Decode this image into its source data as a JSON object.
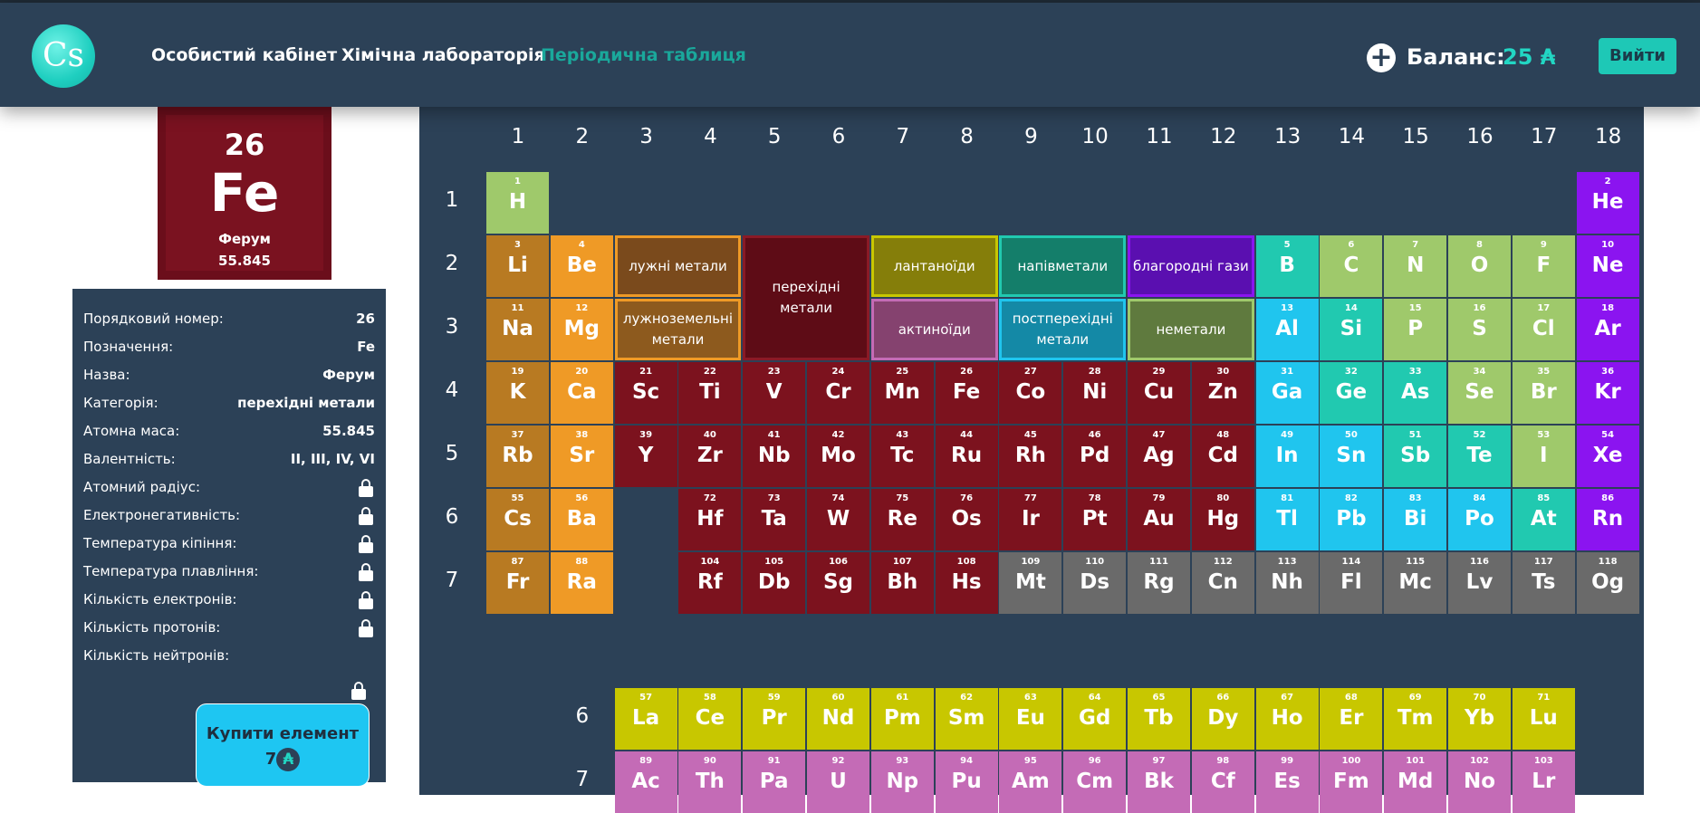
{
  "header": {
    "logo_text": "Cs",
    "nav": [
      "Особистий кабінет",
      "Хімічна лабораторія",
      "Періодична таблиця"
    ],
    "balance_label": "Баланс:",
    "balance_value": "25 ₳",
    "login": "Вийти"
  },
  "selected": {
    "number": "26",
    "symbol": "Fe",
    "name": "Ферум",
    "mass": "55.845"
  },
  "info": [
    {
      "label": "Порядковий номер:",
      "value": "26"
    },
    {
      "label": "Позначення:",
      "value": "Fe"
    },
    {
      "label": "Назва:",
      "value": "Ферум"
    },
    {
      "label": "Категорія:",
      "value": "перехідні метали"
    },
    {
      "label": "Атомна маса:",
      "value": "55.845"
    },
    {
      "label": "Валентність:",
      "value": "II, III, IV, VI"
    },
    {
      "label": "Атомний радіус:",
      "locked": true
    },
    {
      "label": "Електронегативність:",
      "locked": true
    },
    {
      "label": "Температура кіпіння:",
      "locked": true
    },
    {
      "label": "Температура плавління:",
      "locked": true
    },
    {
      "label": "Кількість електронів:",
      "locked": true
    },
    {
      "label": "Кількість протонів:",
      "locked": true
    },
    {
      "label": "Кількість нейтронів:",
      "locked": true
    }
  ],
  "buy": {
    "label": "Купити елемент",
    "price": "7",
    "currency": "₳"
  },
  "groups": [
    "1",
    "2",
    "3",
    "4",
    "5",
    "6",
    "7",
    "8",
    "9",
    "10",
    "11",
    "12",
    "13",
    "14",
    "15",
    "16",
    "17",
    "18"
  ],
  "periods": [
    "1",
    "2",
    "3",
    "4",
    "5",
    "6",
    "7"
  ],
  "series_period_labels": [
    "6",
    "7"
  ],
  "category_colors": {
    "alkali": "#b87a22",
    "alkaline": "#ef9a26",
    "transition": "#7c121e",
    "lanthanoid": "#c8c700",
    "actinoid": "#c46bb6",
    "metalloid": "#21c9b0",
    "noble": "#8b14f0",
    "post": "#20c5ee",
    "nonmetal": "#9fc96b",
    "unknown": "#6a6a6a"
  },
  "legend": [
    {
      "key": "alkali",
      "label": "лужні метали"
    },
    {
      "key": "alkaline",
      "label": "лужноземельні метали"
    },
    {
      "key": "transition",
      "label": "перехідні метали"
    },
    {
      "key": "lanthanoid",
      "label": "лантаноїди"
    },
    {
      "key": "actinoid",
      "label": "актиноїди"
    },
    {
      "key": "metalloid",
      "label": "напівметали"
    },
    {
      "key": "post",
      "label": "постперехідні метали"
    },
    {
      "key": "noble",
      "label": "благородні гази"
    },
    {
      "key": "nonmetal",
      "label": "неметали"
    }
  ],
  "elements": [
    {
      "n": 1,
      "s": "H",
      "c": "nonmetal",
      "g": 1,
      "p": 1
    },
    {
      "n": 2,
      "s": "He",
      "c": "noble",
      "g": 18,
      "p": 1
    },
    {
      "n": 3,
      "s": "Li",
      "c": "alkali",
      "g": 1,
      "p": 2
    },
    {
      "n": 4,
      "s": "Be",
      "c": "alkaline",
      "g": 2,
      "p": 2
    },
    {
      "n": 5,
      "s": "B",
      "c": "metalloid",
      "g": 13,
      "p": 2
    },
    {
      "n": 6,
      "s": "C",
      "c": "nonmetal",
      "g": 14,
      "p": 2
    },
    {
      "n": 7,
      "s": "N",
      "c": "nonmetal",
      "g": 15,
      "p": 2
    },
    {
      "n": 8,
      "s": "O",
      "c": "nonmetal",
      "g": 16,
      "p": 2
    },
    {
      "n": 9,
      "s": "F",
      "c": "nonmetal",
      "g": 17,
      "p": 2
    },
    {
      "n": 10,
      "s": "Ne",
      "c": "noble",
      "g": 18,
      "p": 2
    },
    {
      "n": 11,
      "s": "Na",
      "c": "alkali",
      "g": 1,
      "p": 3
    },
    {
      "n": 12,
      "s": "Mg",
      "c": "alkaline",
      "g": 2,
      "p": 3
    },
    {
      "n": 13,
      "s": "Al",
      "c": "post",
      "g": 13,
      "p": 3
    },
    {
      "n": 14,
      "s": "Si",
      "c": "metalloid",
      "g": 14,
      "p": 3
    },
    {
      "n": 15,
      "s": "P",
      "c": "nonmetal",
      "g": 15,
      "p": 3
    },
    {
      "n": 16,
      "s": "S",
      "c": "nonmetal",
      "g": 16,
      "p": 3
    },
    {
      "n": 17,
      "s": "Cl",
      "c": "nonmetal",
      "g": 17,
      "p": 3
    },
    {
      "n": 18,
      "s": "Ar",
      "c": "noble",
      "g": 18,
      "p": 3
    },
    {
      "n": 19,
      "s": "K",
      "c": "alkali",
      "g": 1,
      "p": 4
    },
    {
      "n": 20,
      "s": "Ca",
      "c": "alkaline",
      "g": 2,
      "p": 4
    },
    {
      "n": 21,
      "s": "Sc",
      "c": "transition",
      "g": 3,
      "p": 4
    },
    {
      "n": 22,
      "s": "Ti",
      "c": "transition",
      "g": 4,
      "p": 4
    },
    {
      "n": 23,
      "s": "V",
      "c": "transition",
      "g": 5,
      "p": 4
    },
    {
      "n": 24,
      "s": "Cr",
      "c": "transition",
      "g": 6,
      "p": 4
    },
    {
      "n": 25,
      "s": "Mn",
      "c": "transition",
      "g": 7,
      "p": 4
    },
    {
      "n": 26,
      "s": "Fe",
      "c": "transition",
      "g": 8,
      "p": 4
    },
    {
      "n": 27,
      "s": "Co",
      "c": "transition",
      "g": 9,
      "p": 4
    },
    {
      "n": 28,
      "s": "Ni",
      "c": "transition",
      "g": 10,
      "p": 4
    },
    {
      "n": 29,
      "s": "Cu",
      "c": "transition",
      "g": 11,
      "p": 4
    },
    {
      "n": 30,
      "s": "Zn",
      "c": "transition",
      "g": 12,
      "p": 4
    },
    {
      "n": 31,
      "s": "Ga",
      "c": "post",
      "g": 13,
      "p": 4
    },
    {
      "n": 32,
      "s": "Ge",
      "c": "metalloid",
      "g": 14,
      "p": 4
    },
    {
      "n": 33,
      "s": "As",
      "c": "metalloid",
      "g": 15,
      "p": 4
    },
    {
      "n": 34,
      "s": "Se",
      "c": "nonmetal",
      "g": 16,
      "p": 4
    },
    {
      "n": 35,
      "s": "Br",
      "c": "nonmetal",
      "g": 17,
      "p": 4
    },
    {
      "n": 36,
      "s": "Kr",
      "c": "noble",
      "g": 18,
      "p": 4
    },
    {
      "n": 37,
      "s": "Rb",
      "c": "alkali",
      "g": 1,
      "p": 5
    },
    {
      "n": 38,
      "s": "Sr",
      "c": "alkaline",
      "g": 2,
      "p": 5
    },
    {
      "n": 39,
      "s": "Y",
      "c": "transition",
      "g": 3,
      "p": 5
    },
    {
      "n": 40,
      "s": "Zr",
      "c": "transition",
      "g": 4,
      "p": 5
    },
    {
      "n": 41,
      "s": "Nb",
      "c": "transition",
      "g": 5,
      "p": 5
    },
    {
      "n": 42,
      "s": "Mo",
      "c": "transition",
      "g": 6,
      "p": 5
    },
    {
      "n": 43,
      "s": "Tc",
      "c": "transition",
      "g": 7,
      "p": 5
    },
    {
      "n": 44,
      "s": "Ru",
      "c": "transition",
      "g": 8,
      "p": 5
    },
    {
      "n": 45,
      "s": "Rh",
      "c": "transition",
      "g": 9,
      "p": 5
    },
    {
      "n": 46,
      "s": "Pd",
      "c": "transition",
      "g": 10,
      "p": 5
    },
    {
      "n": 47,
      "s": "Ag",
      "c": "transition",
      "g": 11,
      "p": 5
    },
    {
      "n": 48,
      "s": "Cd",
      "c": "transition",
      "g": 12,
      "p": 5
    },
    {
      "n": 49,
      "s": "In",
      "c": "post",
      "g": 13,
      "p": 5
    },
    {
      "n": 50,
      "s": "Sn",
      "c": "post",
      "g": 14,
      "p": 5
    },
    {
      "n": 51,
      "s": "Sb",
      "c": "metalloid",
      "g": 15,
      "p": 5
    },
    {
      "n": 52,
      "s": "Te",
      "c": "metalloid",
      "g": 16,
      "p": 5
    },
    {
      "n": 53,
      "s": "I",
      "c": "nonmetal",
      "g": 17,
      "p": 5
    },
    {
      "n": 54,
      "s": "Xe",
      "c": "noble",
      "g": 18,
      "p": 5
    },
    {
      "n": 55,
      "s": "Cs",
      "c": "alkali",
      "g": 1,
      "p": 6
    },
    {
      "n": 56,
      "s": "Ba",
      "c": "alkaline",
      "g": 2,
      "p": 6
    },
    {
      "n": 72,
      "s": "Hf",
      "c": "transition",
      "g": 4,
      "p": 6
    },
    {
      "n": 73,
      "s": "Ta",
      "c": "transition",
      "g": 5,
      "p": 6
    },
    {
      "n": 74,
      "s": "W",
      "c": "transition",
      "g": 6,
      "p": 6
    },
    {
      "n": 75,
      "s": "Re",
      "c": "transition",
      "g": 7,
      "p": 6
    },
    {
      "n": 76,
      "s": "Os",
      "c": "transition",
      "g": 8,
      "p": 6
    },
    {
      "n": 77,
      "s": "Ir",
      "c": "transition",
      "g": 9,
      "p": 6
    },
    {
      "n": 78,
      "s": "Pt",
      "c": "transition",
      "g": 10,
      "p": 6
    },
    {
      "n": 79,
      "s": "Au",
      "c": "transition",
      "g": 11,
      "p": 6
    },
    {
      "n": 80,
      "s": "Hg",
      "c": "transition",
      "g": 12,
      "p": 6
    },
    {
      "n": 81,
      "s": "Tl",
      "c": "post",
      "g": 13,
      "p": 6
    },
    {
      "n": 82,
      "s": "Pb",
      "c": "post",
      "g": 14,
      "p": 6
    },
    {
      "n": 83,
      "s": "Bi",
      "c": "post",
      "g": 15,
      "p": 6
    },
    {
      "n": 84,
      "s": "Po",
      "c": "post",
      "g": 16,
      "p": 6
    },
    {
      "n": 85,
      "s": "At",
      "c": "metalloid",
      "g": 17,
      "p": 6
    },
    {
      "n": 86,
      "s": "Rn",
      "c": "noble",
      "g": 18,
      "p": 6
    },
    {
      "n": 87,
      "s": "Fr",
      "c": "alkali",
      "g": 1,
      "p": 7
    },
    {
      "n": 88,
      "s": "Ra",
      "c": "alkaline",
      "g": 2,
      "p": 7
    },
    {
      "n": 104,
      "s": "Rf",
      "c": "transition",
      "g": 4,
      "p": 7
    },
    {
      "n": 105,
      "s": "Db",
      "c": "transition",
      "g": 5,
      "p": 7
    },
    {
      "n": 106,
      "s": "Sg",
      "c": "transition",
      "g": 6,
      "p": 7
    },
    {
      "n": 107,
      "s": "Bh",
      "c": "transition",
      "g": 7,
      "p": 7
    },
    {
      "n": 108,
      "s": "Hs",
      "c": "transition",
      "g": 8,
      "p": 7
    },
    {
      "n": 109,
      "s": "Mt",
      "c": "unknown",
      "g": 9,
      "p": 7
    },
    {
      "n": 110,
      "s": "Ds",
      "c": "unknown",
      "g": 10,
      "p": 7
    },
    {
      "n": 111,
      "s": "Rg",
      "c": "unknown",
      "g": 11,
      "p": 7
    },
    {
      "n": 112,
      "s": "Cn",
      "c": "unknown",
      "g": 12,
      "p": 7
    },
    {
      "n": 113,
      "s": "Nh",
      "c": "unknown",
      "g": 13,
      "p": 7
    },
    {
      "n": 114,
      "s": "Fl",
      "c": "unknown",
      "g": 14,
      "p": 7
    },
    {
      "n": 115,
      "s": "Mc",
      "c": "unknown",
      "g": 15,
      "p": 7
    },
    {
      "n": 116,
      "s": "Lv",
      "c": "unknown",
      "g": 16,
      "p": 7
    },
    {
      "n": 117,
      "s": "Ts",
      "c": "unknown",
      "g": 17,
      "p": 7
    },
    {
      "n": 118,
      "s": "Og",
      "c": "unknown",
      "g": 18,
      "p": 7
    }
  ],
  "lanthanoids": [
    {
      "n": 57,
      "s": "La"
    },
    {
      "n": 58,
      "s": "Ce"
    },
    {
      "n": 59,
      "s": "Pr"
    },
    {
      "n": 60,
      "s": "Nd"
    },
    {
      "n": 61,
      "s": "Pm"
    },
    {
      "n": 62,
      "s": "Sm"
    },
    {
      "n": 63,
      "s": "Eu"
    },
    {
      "n": 64,
      "s": "Gd"
    },
    {
      "n": 65,
      "s": "Tb"
    },
    {
      "n": 66,
      "s": "Dy"
    },
    {
      "n": 67,
      "s": "Ho"
    },
    {
      "n": 68,
      "s": "Er"
    },
    {
      "n": 69,
      "s": "Tm"
    },
    {
      "n": 70,
      "s": "Yb"
    },
    {
      "n": 71,
      "s": "Lu"
    }
  ],
  "actinoids": [
    {
      "n": 89,
      "s": "Ac"
    },
    {
      "n": 90,
      "s": "Th"
    },
    {
      "n": 91,
      "s": "Pa"
    },
    {
      "n": 92,
      "s": "U"
    },
    {
      "n": 93,
      "s": "Np"
    },
    {
      "n": 94,
      "s": "Pu"
    },
    {
      "n": 95,
      "s": "Am"
    },
    {
      "n": 96,
      "s": "Cm"
    },
    {
      "n": 97,
      "s": "Bk"
    },
    {
      "n": 98,
      "s": "Cf"
    },
    {
      "n": 99,
      "s": "Es"
    },
    {
      "n": 100,
      "s": "Fm"
    },
    {
      "n": 101,
      "s": "Md"
    },
    {
      "n": 102,
      "s": "No"
    },
    {
      "n": 103,
      "s": "Lr"
    }
  ]
}
